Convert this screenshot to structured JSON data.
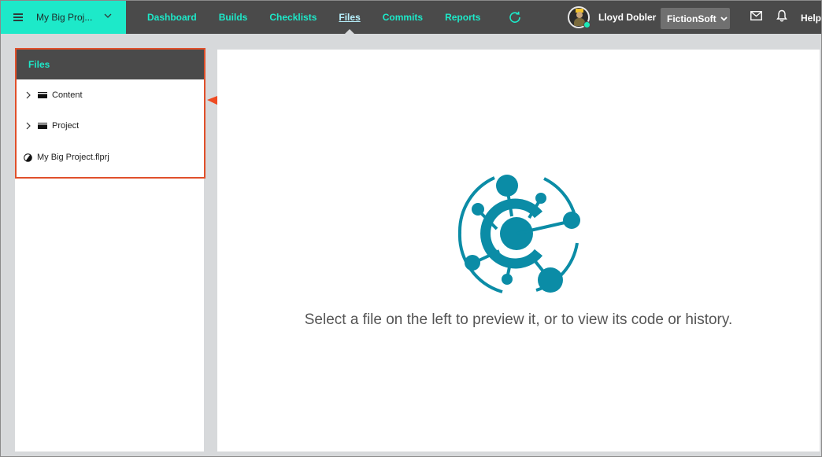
{
  "topbar": {
    "project_name": "My Big Proj...",
    "nav": [
      {
        "label": "Dashboard",
        "active": false
      },
      {
        "label": "Builds",
        "active": false
      },
      {
        "label": "Checklists",
        "active": false
      },
      {
        "label": "Files",
        "active": true
      },
      {
        "label": "Commits",
        "active": false
      },
      {
        "label": "Reports",
        "active": false
      }
    ],
    "user_name": "Lloyd Dobler",
    "org_name": "FictionSoft",
    "help_label": "Help"
  },
  "files_panel": {
    "title": "Files",
    "items": [
      {
        "label": "Content",
        "type": "folder",
        "icon": "folder-icon"
      },
      {
        "label": "Project",
        "type": "folder",
        "icon": "folder-icon"
      },
      {
        "label": "My Big Project.flprj",
        "type": "file",
        "icon": "project-file-icon"
      }
    ]
  },
  "main": {
    "empty_message": "Select a file on the left to preview it, or to view its code or history."
  },
  "colors": {
    "accent": "#1de9c9",
    "topbar_bg": "#4a4a4a",
    "highlight_border": "#e0502b",
    "logo": "#0b8ca6"
  }
}
